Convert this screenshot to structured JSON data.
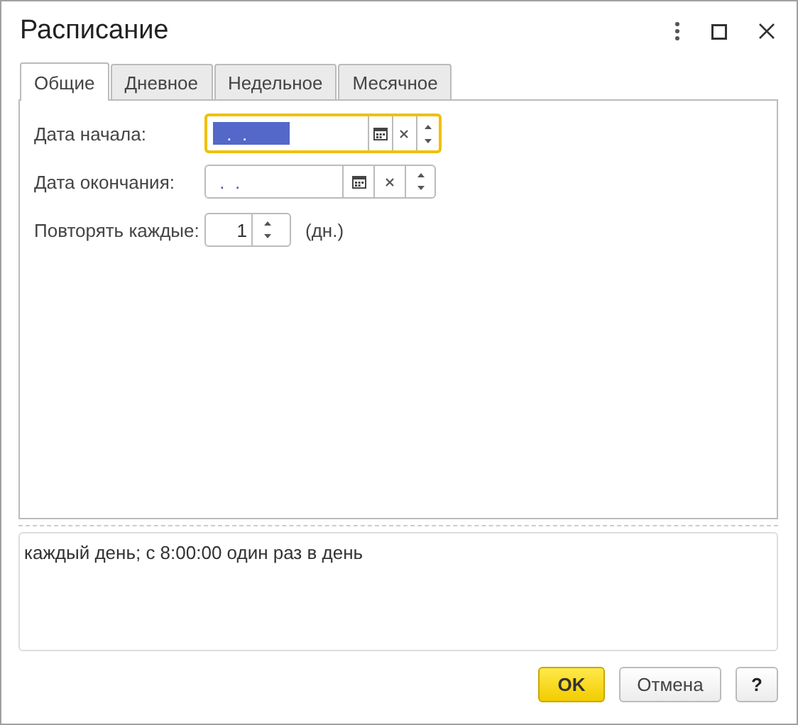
{
  "window": {
    "title": "Расписание"
  },
  "tabs": [
    {
      "label": "Общие",
      "selected": true
    },
    {
      "label": "Дневное",
      "selected": false
    },
    {
      "label": "Недельное",
      "selected": false
    },
    {
      "label": "Месячное",
      "selected": false
    }
  ],
  "fields": [
    {
      "kind": "date",
      "label": "Дата начала:",
      "value": " .  .",
      "focused": true
    },
    {
      "kind": "date",
      "label": "Дата окончания:",
      "value": " .  .",
      "focused": false
    },
    {
      "kind": "number",
      "label": "Повторять каждые:",
      "value": "1",
      "unit": "(дн.)",
      "focused": false
    }
  ],
  "description": "каждый день; с 8:00:00 один раз в день",
  "buttons": [
    {
      "label": "OK",
      "kind": "default"
    },
    {
      "label": "Отмена",
      "kind": "normal"
    },
    {
      "label": "?",
      "kind": "help"
    }
  ]
}
